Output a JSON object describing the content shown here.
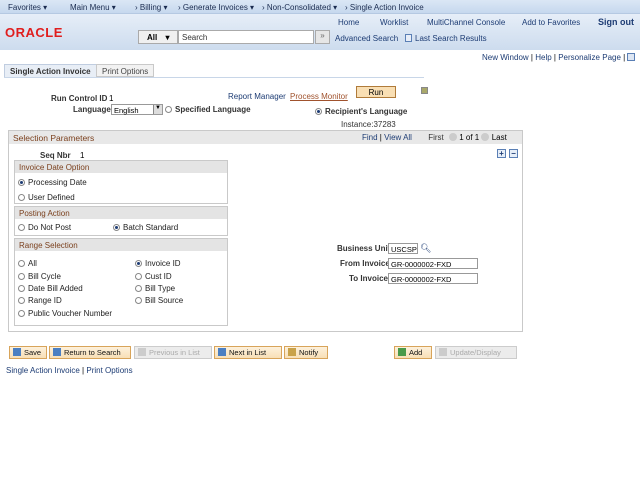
{
  "nav": {
    "favorites": "Favorites ▾",
    "main_menu": "Main Menu ▾",
    "breadcrumbs": [
      "› Billing ▾",
      "› Generate Invoices ▾",
      "› Non-Consolidated ▾",
      "› Single Action Invoice"
    ]
  },
  "header": {
    "logo": "ORACLE",
    "links": [
      "Home",
      "Worklist",
      "MultiChannel Console",
      "Add to Favorites",
      "Sign out"
    ],
    "search_scope": "All",
    "search_placeholder": "Search",
    "advanced_search": "Advanced Search",
    "last_search_results": "Last Search Results"
  },
  "utility": {
    "new_window": "New Window",
    "help": "Help",
    "personalize": "Personalize Page"
  },
  "tabs": [
    "Single Action Invoice",
    "Print Options"
  ],
  "run": {
    "run_control_label": "Run Control ID",
    "run_control_value": "1",
    "language_label": "Language",
    "language_value": "English",
    "specified_language": "Specified Language",
    "recipients_language": "Recipient's Language",
    "report_manager": "Report Manager",
    "process_monitor": "Process Monitor",
    "run_button": "Run",
    "instance": "Instance:37283"
  },
  "selection": {
    "title": "Selection Parameters",
    "find": "Find",
    "view_all": "View All",
    "first": "First",
    "pager": "1 of 1",
    "last": "Last",
    "seq_label": "Seq Nbr",
    "seq_value": "1",
    "invoice_date": {
      "title": "Invoice Date Option",
      "options": [
        "Processing Date",
        "User Defined"
      ],
      "selected": 0
    },
    "posting": {
      "title": "Posting Action",
      "options": [
        "Do Not Post",
        "Batch Standard"
      ],
      "selected": 1
    },
    "range": {
      "title": "Range Selection",
      "options": [
        "All",
        "Invoice ID",
        "Bill Cycle",
        "Cust ID",
        "Date Bill Added",
        "Bill Type",
        "Range ID",
        "Bill Source",
        "Public Voucher Number"
      ],
      "selected": 1
    },
    "business_unit_label": "Business Unit",
    "business_unit": "USCSP",
    "from_invoice_label": "From Invoice",
    "from_invoice": "GR-0000002-FXD",
    "to_invoice_label": "To Invoice",
    "to_invoice": "GR-0000002-FXD"
  },
  "toolbar": {
    "save": "Save",
    "return": "Return to Search",
    "previous": "Previous in List",
    "next": "Next in List",
    "notify": "Notify",
    "add": "Add",
    "update": "Update/Display"
  },
  "footer_links": [
    "Single Action Invoice",
    "Print Options"
  ]
}
